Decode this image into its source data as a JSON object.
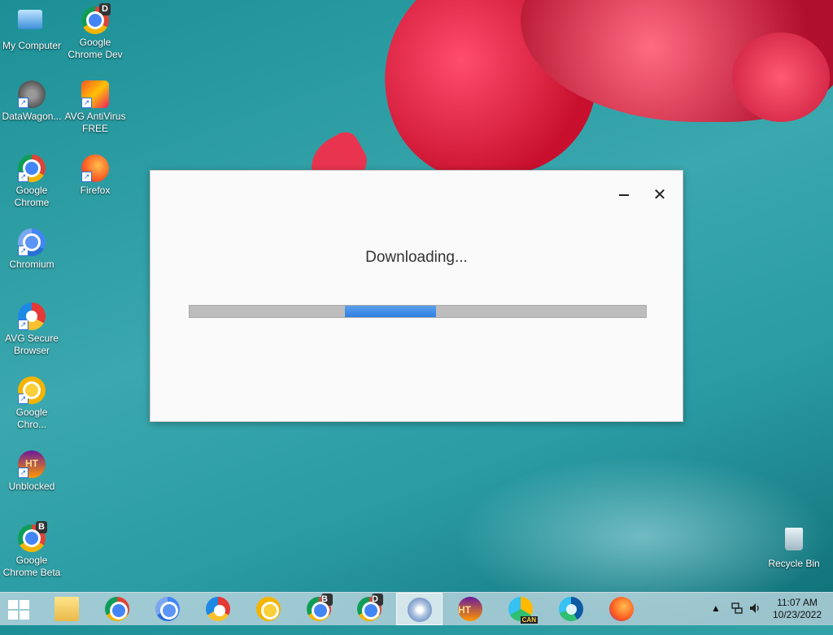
{
  "desktop": {
    "icons": [
      {
        "label": "My Computer"
      },
      {
        "label": "Google Chrome Dev"
      },
      {
        "label": "DataWagon..."
      },
      {
        "label": "AVG AntiVirus FREE"
      },
      {
        "label": "Google Chrome"
      },
      {
        "label": "Firefox"
      },
      {
        "label": "Chromium"
      },
      {
        "label": "AVG Secure Browser"
      },
      {
        "label": "Google Chro..."
      },
      {
        "label": "Unblocked"
      },
      {
        "label": "Google Chrome Beta"
      },
      {
        "label": "Recycle Bin"
      }
    ]
  },
  "dialog": {
    "status_text": "Downloading...",
    "minimize_icon": "minimize-icon",
    "close_glyph": "✕",
    "progress": {
      "fill_start_fraction": 0.34,
      "fill_end_fraction": 0.54
    }
  },
  "taskbar": {
    "edge_can_badge": "CAN",
    "ht_label": "HT",
    "badge_b": "B",
    "badge_d": "D"
  },
  "clock": {
    "time": "11:07 AM",
    "date": "10/23/2022"
  }
}
